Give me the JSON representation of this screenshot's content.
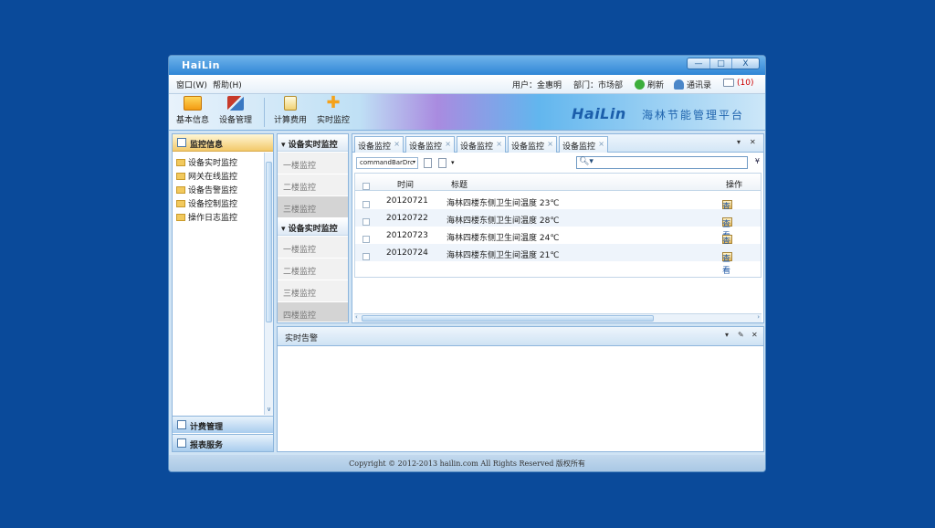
{
  "window": {
    "title": "HaiLin",
    "controls": {
      "minimize": "—",
      "maximize": "□",
      "close": "X"
    }
  },
  "menu": {
    "window_label": "窗口(W)",
    "help_label": "帮助(H)",
    "user_text": "用户：金惠明",
    "dept_text": "部门：市场部",
    "refresh_label": "刷新",
    "contacts_label": "通讯录",
    "messages_count": "(10)"
  },
  "toolbar": {
    "buttons": [
      {
        "label": "基本信息"
      },
      {
        "label": "设备管理"
      },
      {
        "label": "计算费用"
      },
      {
        "label": "实时监控"
      }
    ],
    "brand_logo": "HaiLin",
    "brand_name": "海林节能管理平台"
  },
  "left_panel": {
    "header": "监控信息",
    "items": [
      "设备实时监控",
      "网关在线监控",
      "设备告警监控",
      "设备控制监控",
      "操作日志监控"
    ],
    "bottom_headers": [
      "计费管理",
      "报表服务"
    ]
  },
  "middle_panel": {
    "groups": [
      {
        "title": "设备实时监控",
        "items": [
          "一楼监控",
          "二楼监控",
          "三楼监控"
        ]
      },
      {
        "title": "设备实时监控",
        "items": [
          "一楼监控",
          "二楼监控",
          "三楼监控",
          "四楼监控"
        ]
      }
    ]
  },
  "content": {
    "tabs": [
      "设备监控",
      "设备监控",
      "设备监控",
      "设备监控",
      "设备监控"
    ],
    "tab_close": "×",
    "command_select": "commandBarDrc",
    "search_placeholder": "",
    "columns": {
      "time": "时间",
      "title": "标题",
      "action": "操作"
    },
    "rows": [
      {
        "time": "20120721",
        "title": "海林四楼东侧卫生间温度 23℃",
        "action": "查看"
      },
      {
        "time": "20120722",
        "title": "海林四楼东侧卫生间温度 28℃",
        "action": "查看"
      },
      {
        "time": "20120723",
        "title": "海林四楼东侧卫生间温度 24℃",
        "action": "查看"
      },
      {
        "time": "20120724",
        "title": "海林四楼东侧卫生间温度 21℃",
        "action": "查看"
      }
    ]
  },
  "alarm_panel": {
    "title": "实时告警"
  },
  "footer": {
    "text": "Copyright © 2012-2013 hailin.com All Rights Reserved 版权所有"
  },
  "colors": {
    "desktop": "#0a4a9a",
    "accent": "#2f86d6",
    "link": "#1e57a4"
  }
}
